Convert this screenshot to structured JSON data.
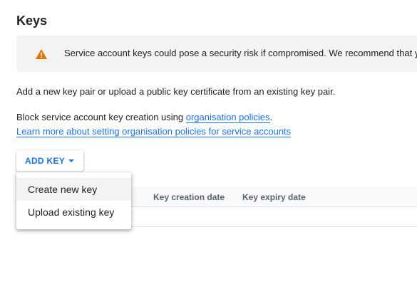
{
  "section": {
    "title": "Keys"
  },
  "warning": {
    "text": "Service account keys could pose a security risk if compromised. We recommend that you avoid downloading service account keys"
  },
  "info": {
    "add_pair_text": "Add a new key pair or upload a public key certificate from an existing key pair.",
    "block_prefix": "Block service account key creation using ",
    "block_link": "organisation policies",
    "block_suffix": ".",
    "learn_more_link": "Learn more about setting organisation policies for service accounts"
  },
  "toolbar": {
    "add_key_label": "ADD KEY"
  },
  "dropdown": {
    "items": [
      {
        "label": "Create new key"
      },
      {
        "label": "Upload existing key"
      }
    ]
  },
  "table": {
    "columns": [
      {
        "label": "Key creation date"
      },
      {
        "label": "Key expiry date"
      }
    ]
  },
  "colors": {
    "accent": "#1a73e8",
    "warning_icon": "#e37400",
    "banner_bg": "#f1f3f4"
  }
}
